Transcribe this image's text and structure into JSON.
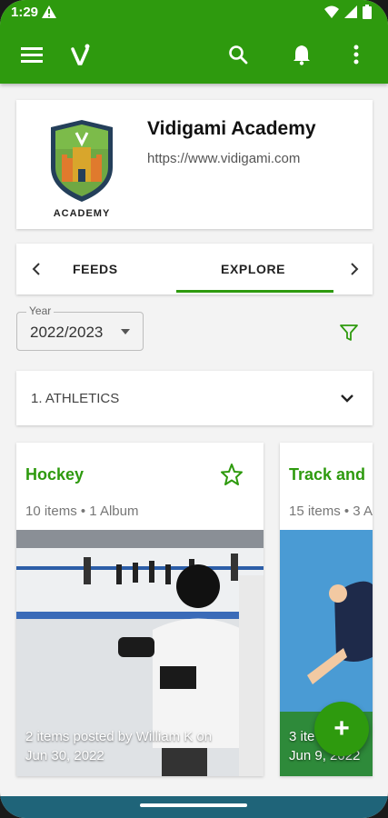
{
  "status_bar": {
    "time": "1:29"
  },
  "org": {
    "name": "Vidigami Academy",
    "url": "https://www.vidigami.com",
    "logo_text": "ACADEMY",
    "logo_letter": "V"
  },
  "tabs": {
    "items": [
      "FEEDS",
      "EXPLORE"
    ],
    "active": "EXPLORE"
  },
  "year_filter": {
    "label": "Year",
    "value": "2022/2023"
  },
  "category": {
    "label": "1. ATHLETICS"
  },
  "albums": [
    {
      "title": "Hockey",
      "meta": "10 items • 1 Album",
      "caption_line1": "2 items posted by William K on",
      "caption_line2": "Jun 30, 2022"
    },
    {
      "title": "Track and",
      "meta": "15 items • 3 A",
      "caption_line1": "3 ite",
      "caption_line2": "Jun 9, 2022"
    }
  ],
  "fab": {
    "label": "+"
  },
  "icons": [
    "menu-icon",
    "vidigami-logo-icon",
    "search-icon",
    "notification-bell-icon",
    "more-vert-icon",
    "filter-icon",
    "chevron-down-icon",
    "star-icon",
    "chevron-left-icon",
    "chevron-right-icon"
  ],
  "colors": {
    "brand_green": "#2e9a0e",
    "nav_bar": "#1f6479"
  }
}
